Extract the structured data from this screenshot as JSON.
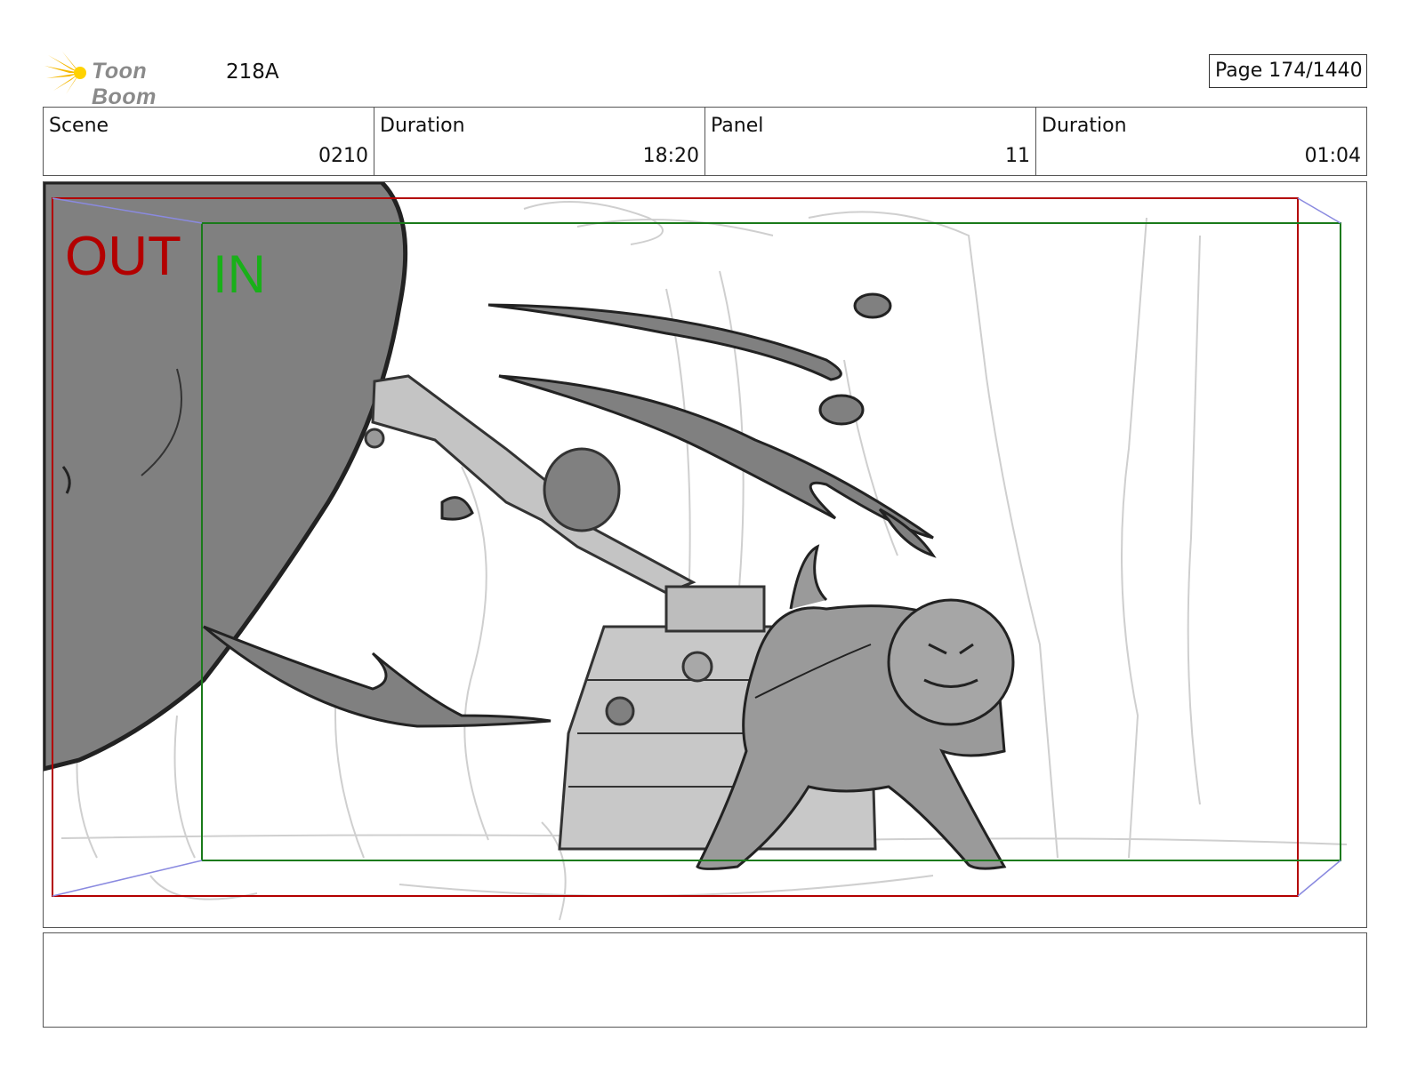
{
  "header": {
    "logo_text": "Toon Boom",
    "episode": "218A",
    "page": "Page  174/1440"
  },
  "info": [
    {
      "label": "Scene",
      "value": "0210"
    },
    {
      "label": "Duration",
      "value": "18:20"
    },
    {
      "label": "Panel",
      "value": "11"
    },
    {
      "label": "Duration",
      "value": "01:04"
    }
  ],
  "panel": {
    "out_label": "OUT",
    "in_label": "IN"
  },
  "caption": {
    "text": ""
  },
  "colors": {
    "out_frame": "#b30000",
    "in_frame": "#1a8a1a",
    "sketch_fill": "#808080"
  }
}
